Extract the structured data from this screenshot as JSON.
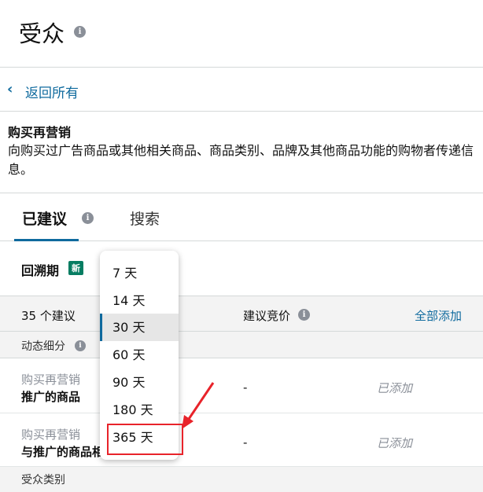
{
  "header": {
    "title": "受众"
  },
  "back": {
    "label": "返回所有"
  },
  "description": {
    "title": "购买再营销",
    "text": "向购买过广告商品或其他相关商品、商品类别、品牌及其他商品功能的购物者传递信息。"
  },
  "tabs": [
    {
      "label": "已建议",
      "active": true
    },
    {
      "label": "搜索",
      "active": false
    }
  ],
  "lookback": {
    "label": "回溯期",
    "badge": "新"
  },
  "table": {
    "count_label": "35 个建议",
    "bid_label": "建议竞价",
    "add_all_label": "全部添加",
    "dynamic_section": "动态细分",
    "rows": [
      {
        "category": "购买再营销",
        "name": "推广的商品",
        "bid": "-",
        "status": "已添加"
      },
      {
        "category": "购买再营销",
        "name": "与推广的商品相",
        "bid": "-",
        "status": "已添加"
      }
    ],
    "audience_section": "受众类别"
  },
  "dropdown": {
    "options": [
      "7 天",
      "14 天",
      "30 天",
      "60 天",
      "90 天",
      "180 天",
      "365 天"
    ],
    "selected": "30 天",
    "highlighted": "365 天"
  },
  "colors": {
    "link": "#0f6a9e",
    "badge": "#067d62",
    "annotation": "#e8232a"
  }
}
